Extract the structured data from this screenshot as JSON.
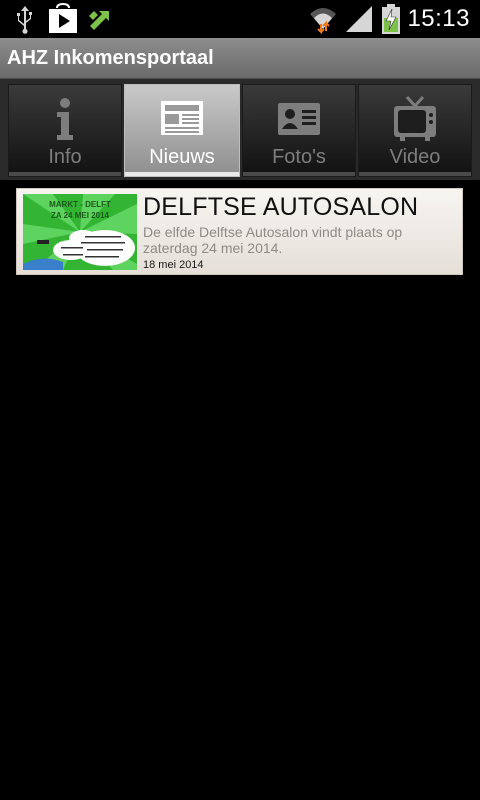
{
  "status_bar": {
    "time": "15:13",
    "icons": [
      "usb-icon",
      "play-store-icon",
      "sync-icon",
      "wifi-icon",
      "signal-icon",
      "battery-charging-icon"
    ]
  },
  "app": {
    "title": "AHZ Inkomensportaal"
  },
  "tabs": [
    {
      "label": "Info",
      "icon": "info-icon",
      "active": false
    },
    {
      "label": "Nieuws",
      "icon": "newspaper-icon",
      "active": true
    },
    {
      "label": "Foto's",
      "icon": "photo-card-icon",
      "active": false
    },
    {
      "label": "Video",
      "icon": "tv-icon",
      "active": false
    }
  ],
  "news": {
    "items": [
      {
        "title": "DELFTSE AUTOSALON",
        "description": "De elfde Delftse Autosalon vindt plaats op zaterdag 24 mei 2014.",
        "date": "18 mei 2014",
        "thumbnail": {
          "line1": "MARKT - DELFT",
          "line2": "ZA 24 MEI 2014"
        }
      }
    ]
  },
  "colors": {
    "background": "#000000",
    "titlebar": "#7d7d7d",
    "tab_active": "#b5b5b5",
    "tab_inactive": "#222222",
    "card": "#efebe6",
    "thumb_green": "#3fbf3f"
  }
}
